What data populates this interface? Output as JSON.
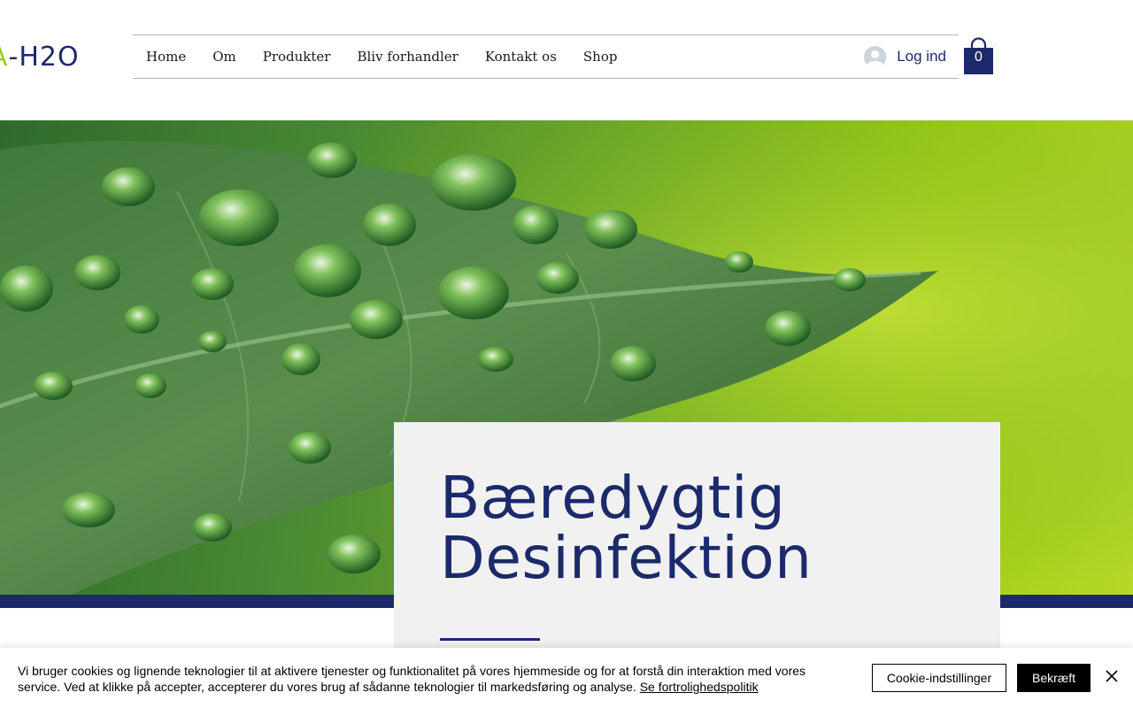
{
  "brand": {
    "logo_text_accent": "A",
    "logo_text_main": "-H2O"
  },
  "nav": {
    "items": [
      {
        "label": "Home"
      },
      {
        "label": "Om"
      },
      {
        "label": "Produkter"
      },
      {
        "label": "Bliv forhandler"
      },
      {
        "label": "Kontakt os"
      },
      {
        "label": "Shop"
      }
    ],
    "login_label": "Log ind"
  },
  "cart": {
    "count": "0",
    "icon": "shopping-bag-icon"
  },
  "hero": {
    "image": "green-leaf-water-droplets",
    "title_line1": "Bæredygtig",
    "title_line2": "Desinfektion"
  },
  "cookie_banner": {
    "text": "Vi bruger cookies og lignende teknologier til at aktivere tjenester og funktionalitet på vores hjemmeside og for at forstå din interaktion med vores service. Ved at klikke på accepter, accepterer du vores brug af sådanne teknologier til markedsføring og analyse. ",
    "link_text": "Se fortrolighedspolitik",
    "settings_label": "Cookie-indstillinger",
    "accept_label": "Bekræft"
  },
  "colors": {
    "brand_navy": "#1c2a6b",
    "brand_lime": "#9ccc1c",
    "card_background": "#f1f1f1",
    "button_black": "#000000"
  }
}
